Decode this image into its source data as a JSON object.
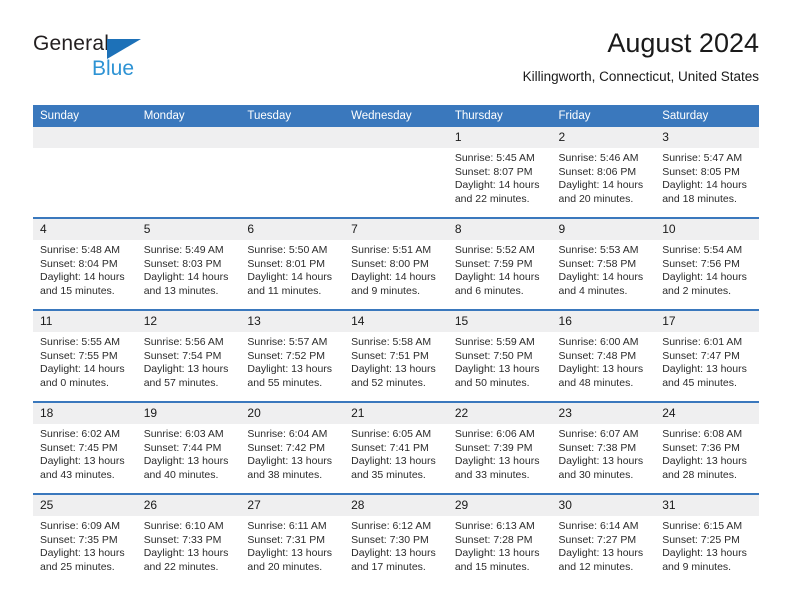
{
  "brand": {
    "name_top": "General",
    "name_bottom": "Blue",
    "triangle_color": "#1d71b8",
    "blue_text_color": "#2e93d4"
  },
  "header": {
    "title": "August 2024",
    "subtitle": "Killingworth, Connecticut, United States"
  },
  "theme": {
    "header_blue": "#3a78bd",
    "daynum_gray": "#efeff0",
    "text": "#1a1a1a"
  },
  "calendar": {
    "weekday_headers": [
      "Sunday",
      "Monday",
      "Tuesday",
      "Wednesday",
      "Thursday",
      "Friday",
      "Saturday"
    ],
    "weeks": [
      [
        {
          "day": "",
          "lines": []
        },
        {
          "day": "",
          "lines": []
        },
        {
          "day": "",
          "lines": []
        },
        {
          "day": "",
          "lines": []
        },
        {
          "day": "1",
          "lines": [
            "Sunrise: 5:45 AM",
            "Sunset: 8:07 PM",
            "Daylight: 14 hours",
            "and 22 minutes."
          ]
        },
        {
          "day": "2",
          "lines": [
            "Sunrise: 5:46 AM",
            "Sunset: 8:06 PM",
            "Daylight: 14 hours",
            "and 20 minutes."
          ]
        },
        {
          "day": "3",
          "lines": [
            "Sunrise: 5:47 AM",
            "Sunset: 8:05 PM",
            "Daylight: 14 hours",
            "and 18 minutes."
          ]
        }
      ],
      [
        {
          "day": "4",
          "lines": [
            "Sunrise: 5:48 AM",
            "Sunset: 8:04 PM",
            "Daylight: 14 hours",
            "and 15 minutes."
          ]
        },
        {
          "day": "5",
          "lines": [
            "Sunrise: 5:49 AM",
            "Sunset: 8:03 PM",
            "Daylight: 14 hours",
            "and 13 minutes."
          ]
        },
        {
          "day": "6",
          "lines": [
            "Sunrise: 5:50 AM",
            "Sunset: 8:01 PM",
            "Daylight: 14 hours",
            "and 11 minutes."
          ]
        },
        {
          "day": "7",
          "lines": [
            "Sunrise: 5:51 AM",
            "Sunset: 8:00 PM",
            "Daylight: 14 hours",
            "and 9 minutes."
          ]
        },
        {
          "day": "8",
          "lines": [
            "Sunrise: 5:52 AM",
            "Sunset: 7:59 PM",
            "Daylight: 14 hours",
            "and 6 minutes."
          ]
        },
        {
          "day": "9",
          "lines": [
            "Sunrise: 5:53 AM",
            "Sunset: 7:58 PM",
            "Daylight: 14 hours",
            "and 4 minutes."
          ]
        },
        {
          "day": "10",
          "lines": [
            "Sunrise: 5:54 AM",
            "Sunset: 7:56 PM",
            "Daylight: 14 hours",
            "and 2 minutes."
          ]
        }
      ],
      [
        {
          "day": "11",
          "lines": [
            "Sunrise: 5:55 AM",
            "Sunset: 7:55 PM",
            "Daylight: 14 hours",
            "and 0 minutes."
          ]
        },
        {
          "day": "12",
          "lines": [
            "Sunrise: 5:56 AM",
            "Sunset: 7:54 PM",
            "Daylight: 13 hours",
            "and 57 minutes."
          ]
        },
        {
          "day": "13",
          "lines": [
            "Sunrise: 5:57 AM",
            "Sunset: 7:52 PM",
            "Daylight: 13 hours",
            "and 55 minutes."
          ]
        },
        {
          "day": "14",
          "lines": [
            "Sunrise: 5:58 AM",
            "Sunset: 7:51 PM",
            "Daylight: 13 hours",
            "and 52 minutes."
          ]
        },
        {
          "day": "15",
          "lines": [
            "Sunrise: 5:59 AM",
            "Sunset: 7:50 PM",
            "Daylight: 13 hours",
            "and 50 minutes."
          ]
        },
        {
          "day": "16",
          "lines": [
            "Sunrise: 6:00 AM",
            "Sunset: 7:48 PM",
            "Daylight: 13 hours",
            "and 48 minutes."
          ]
        },
        {
          "day": "17",
          "lines": [
            "Sunrise: 6:01 AM",
            "Sunset: 7:47 PM",
            "Daylight: 13 hours",
            "and 45 minutes."
          ]
        }
      ],
      [
        {
          "day": "18",
          "lines": [
            "Sunrise: 6:02 AM",
            "Sunset: 7:45 PM",
            "Daylight: 13 hours",
            "and 43 minutes."
          ]
        },
        {
          "day": "19",
          "lines": [
            "Sunrise: 6:03 AM",
            "Sunset: 7:44 PM",
            "Daylight: 13 hours",
            "and 40 minutes."
          ]
        },
        {
          "day": "20",
          "lines": [
            "Sunrise: 6:04 AM",
            "Sunset: 7:42 PM",
            "Daylight: 13 hours",
            "and 38 minutes."
          ]
        },
        {
          "day": "21",
          "lines": [
            "Sunrise: 6:05 AM",
            "Sunset: 7:41 PM",
            "Daylight: 13 hours",
            "and 35 minutes."
          ]
        },
        {
          "day": "22",
          "lines": [
            "Sunrise: 6:06 AM",
            "Sunset: 7:39 PM",
            "Daylight: 13 hours",
            "and 33 minutes."
          ]
        },
        {
          "day": "23",
          "lines": [
            "Sunrise: 6:07 AM",
            "Sunset: 7:38 PM",
            "Daylight: 13 hours",
            "and 30 minutes."
          ]
        },
        {
          "day": "24",
          "lines": [
            "Sunrise: 6:08 AM",
            "Sunset: 7:36 PM",
            "Daylight: 13 hours",
            "and 28 minutes."
          ]
        }
      ],
      [
        {
          "day": "25",
          "lines": [
            "Sunrise: 6:09 AM",
            "Sunset: 7:35 PM",
            "Daylight: 13 hours",
            "and 25 minutes."
          ]
        },
        {
          "day": "26",
          "lines": [
            "Sunrise: 6:10 AM",
            "Sunset: 7:33 PM",
            "Daylight: 13 hours",
            "and 22 minutes."
          ]
        },
        {
          "day": "27",
          "lines": [
            "Sunrise: 6:11 AM",
            "Sunset: 7:31 PM",
            "Daylight: 13 hours",
            "and 20 minutes."
          ]
        },
        {
          "day": "28",
          "lines": [
            "Sunrise: 6:12 AM",
            "Sunset: 7:30 PM",
            "Daylight: 13 hours",
            "and 17 minutes."
          ]
        },
        {
          "day": "29",
          "lines": [
            "Sunrise: 6:13 AM",
            "Sunset: 7:28 PM",
            "Daylight: 13 hours",
            "and 15 minutes."
          ]
        },
        {
          "day": "30",
          "lines": [
            "Sunrise: 6:14 AM",
            "Sunset: 7:27 PM",
            "Daylight: 13 hours",
            "and 12 minutes."
          ]
        },
        {
          "day": "31",
          "lines": [
            "Sunrise: 6:15 AM",
            "Sunset: 7:25 PM",
            "Daylight: 13 hours",
            "and 9 minutes."
          ]
        }
      ]
    ]
  }
}
